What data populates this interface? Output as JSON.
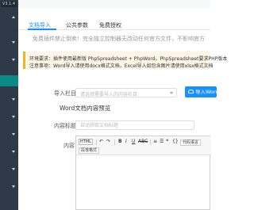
{
  "sidebar": {
    "version": "V3.1.4"
  },
  "tabs": [
    {
      "label": "文档导入"
    },
    {
      "label": "公共参数"
    },
    {
      "label": "免费授权"
    }
  ],
  "notice": "免费插件禁止倒卖！完全独立控制器无改动任何官方文件，不影响官方",
  "env": {
    "line1_key": "环境要求：",
    "line1_text": "插件使用最新版 PhpSpreadsheet + PhpWord。PhpSpreadsheet要求PHP版本",
    "line2_key": "注意事项：",
    "line2_text": "Word导入请使用docx格式文档，Excel导入如包含图片请使用xlsx格式文档"
  },
  "form": {
    "column_label": "导入栏目",
    "column_placeholder": "请选择需要导入的内容栏目",
    "import_button": "导入WordSt",
    "section_title": "Word文档内容预览",
    "title_label": "内容标题",
    "title_placeholder": "自动获取文档标题",
    "content_label": "内容"
  },
  "toolbar": {
    "html": "HTML",
    "undo": "↶",
    "redo": "↷",
    "bold": "B",
    "italic": "I",
    "underline": "U",
    "strike": "ABC",
    "align": "≡",
    "list": "☰",
    "quote": "❝",
    "code": "{}",
    "format": "段落格式",
    "code_lang": "代码语言"
  }
}
